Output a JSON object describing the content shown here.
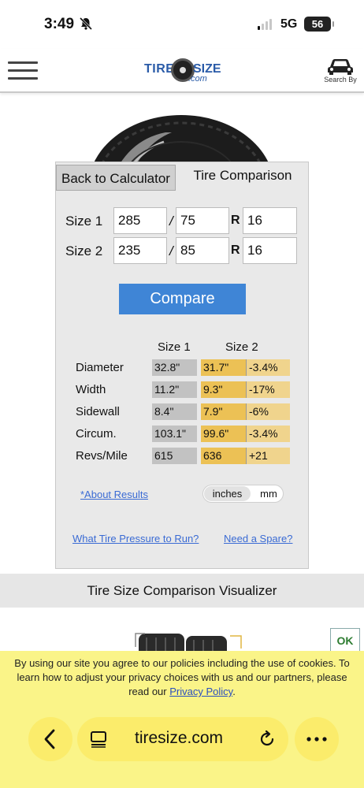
{
  "status_bar": {
    "time": "3:49",
    "network": "5G",
    "battery": "56"
  },
  "header": {
    "logo_part1": "TIRE",
    "logo_part2": "SIZE",
    "logo_domain": ".com",
    "search_by_label": "Search By"
  },
  "tabs": {
    "back_label": "Back to Calculator",
    "active_label": "Tire Comparison"
  },
  "sizes": [
    {
      "label": "Size 1",
      "width": "285",
      "aspect": "75",
      "rim": "16"
    },
    {
      "label": "Size 2",
      "width": "235",
      "aspect": "85",
      "rim": "16"
    }
  ],
  "separators": {
    "slash": "/",
    "r": "R"
  },
  "compare_button": "Compare",
  "results": {
    "col_size1": "Size 1",
    "col_size2": "Size 2",
    "rows": [
      {
        "label": "Diameter",
        "size1": "32.8\"",
        "size2": "31.7\"",
        "diff": "-3.4%"
      },
      {
        "label": "Width",
        "size1": "11.2\"",
        "size2": "9.3\"",
        "diff": "-17%"
      },
      {
        "label": "Sidewall",
        "size1": "8.4\"",
        "size2": "7.9\"",
        "diff": "-6%"
      },
      {
        "label": "Circum.",
        "size1": "103.1\"",
        "size2": "99.6\"",
        "diff": "-3.4%"
      },
      {
        "label": "Revs/Mile",
        "size1": "615",
        "size2": "636",
        "diff": "+21"
      }
    ]
  },
  "about_link": "*About Results",
  "unit_toggle": {
    "inches": "inches",
    "mm": "mm",
    "selected": "inches"
  },
  "links": {
    "pressure": "What Tire Pressure to Run?",
    "spare": "Need a Spare?"
  },
  "visualizer_title": "Tire Size Comparison Visualizer",
  "ok_button": "OK",
  "cookie": {
    "text": "By using our site you agree to our policies including the use of cookies. To learn how to adjust your privacy choices with us and our partners, please read our ",
    "link": "Privacy Policy",
    "end": "."
  },
  "browser": {
    "url": "tiresize.com"
  },
  "colors": {
    "compare_button": "#3f85d6",
    "size1_cell": "#c2c2c2",
    "size2_cell": "#ecc155",
    "diff_cell": "#f0d48d",
    "cookie_banner": "#faf488",
    "link": "#3a6bd4"
  }
}
